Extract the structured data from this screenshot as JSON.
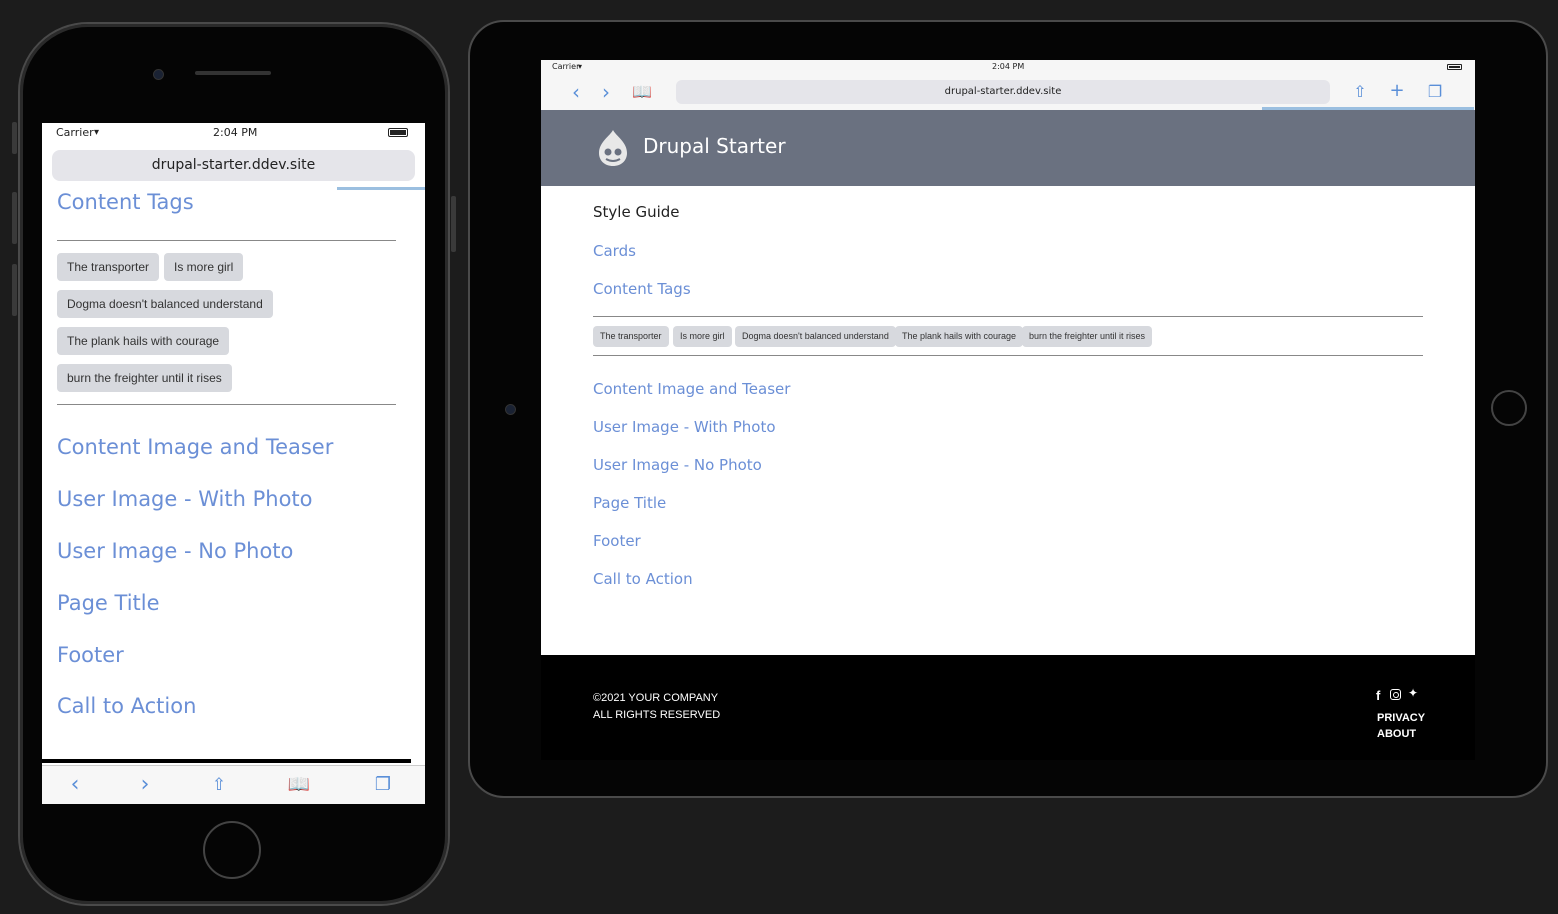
{
  "phone": {
    "status": {
      "carrier": "Carrier",
      "time": "2:04 PM"
    },
    "url": "drupal-starter.ddev.site",
    "heading": "Content Tags",
    "tags": [
      "The transporter",
      "Is more girl",
      "Dogma doesn't balanced understand",
      "The plank hails with courage",
      "burn the freighter until it rises"
    ],
    "links": [
      "Content Image and Teaser",
      "User Image - With Photo",
      "User Image - No Photo",
      "Page Title",
      "Footer",
      "Call to Action"
    ],
    "toolbar_icons": [
      "back-icon",
      "forward-icon",
      "share-icon",
      "bookmarks-icon",
      "tabs-icon"
    ]
  },
  "tablet": {
    "status": {
      "carrier": "Carrier",
      "time": "2:04 PM"
    },
    "url": "drupal-starter.ddev.site",
    "site_name": "Drupal Starter",
    "style_guide": "Style Guide",
    "links_top": [
      "Cards",
      "Content Tags"
    ],
    "tags": [
      "The transporter",
      "Is more girl",
      "Dogma doesn't balanced understand",
      "The plank hails with courage",
      "burn the freighter until it rises"
    ],
    "links": [
      "Content Image and Teaser",
      "User Image - With Photo",
      "User Image - No Photo",
      "Page Title",
      "Footer",
      "Call to Action"
    ],
    "footer": {
      "copyright": "©2021 YOUR COMPANY",
      "rights": "ALL RIGHTS RESERVED",
      "social_icons": [
        "facebook-icon",
        "instagram-icon",
        "twitter-icon"
      ],
      "privacy": "PRIVACY",
      "about": "ABOUT"
    }
  },
  "colors": {
    "link": "#6b8fd6",
    "header": "#6a7180",
    "tag_bg": "#d7d9de",
    "accent": "#5a8fd8"
  }
}
